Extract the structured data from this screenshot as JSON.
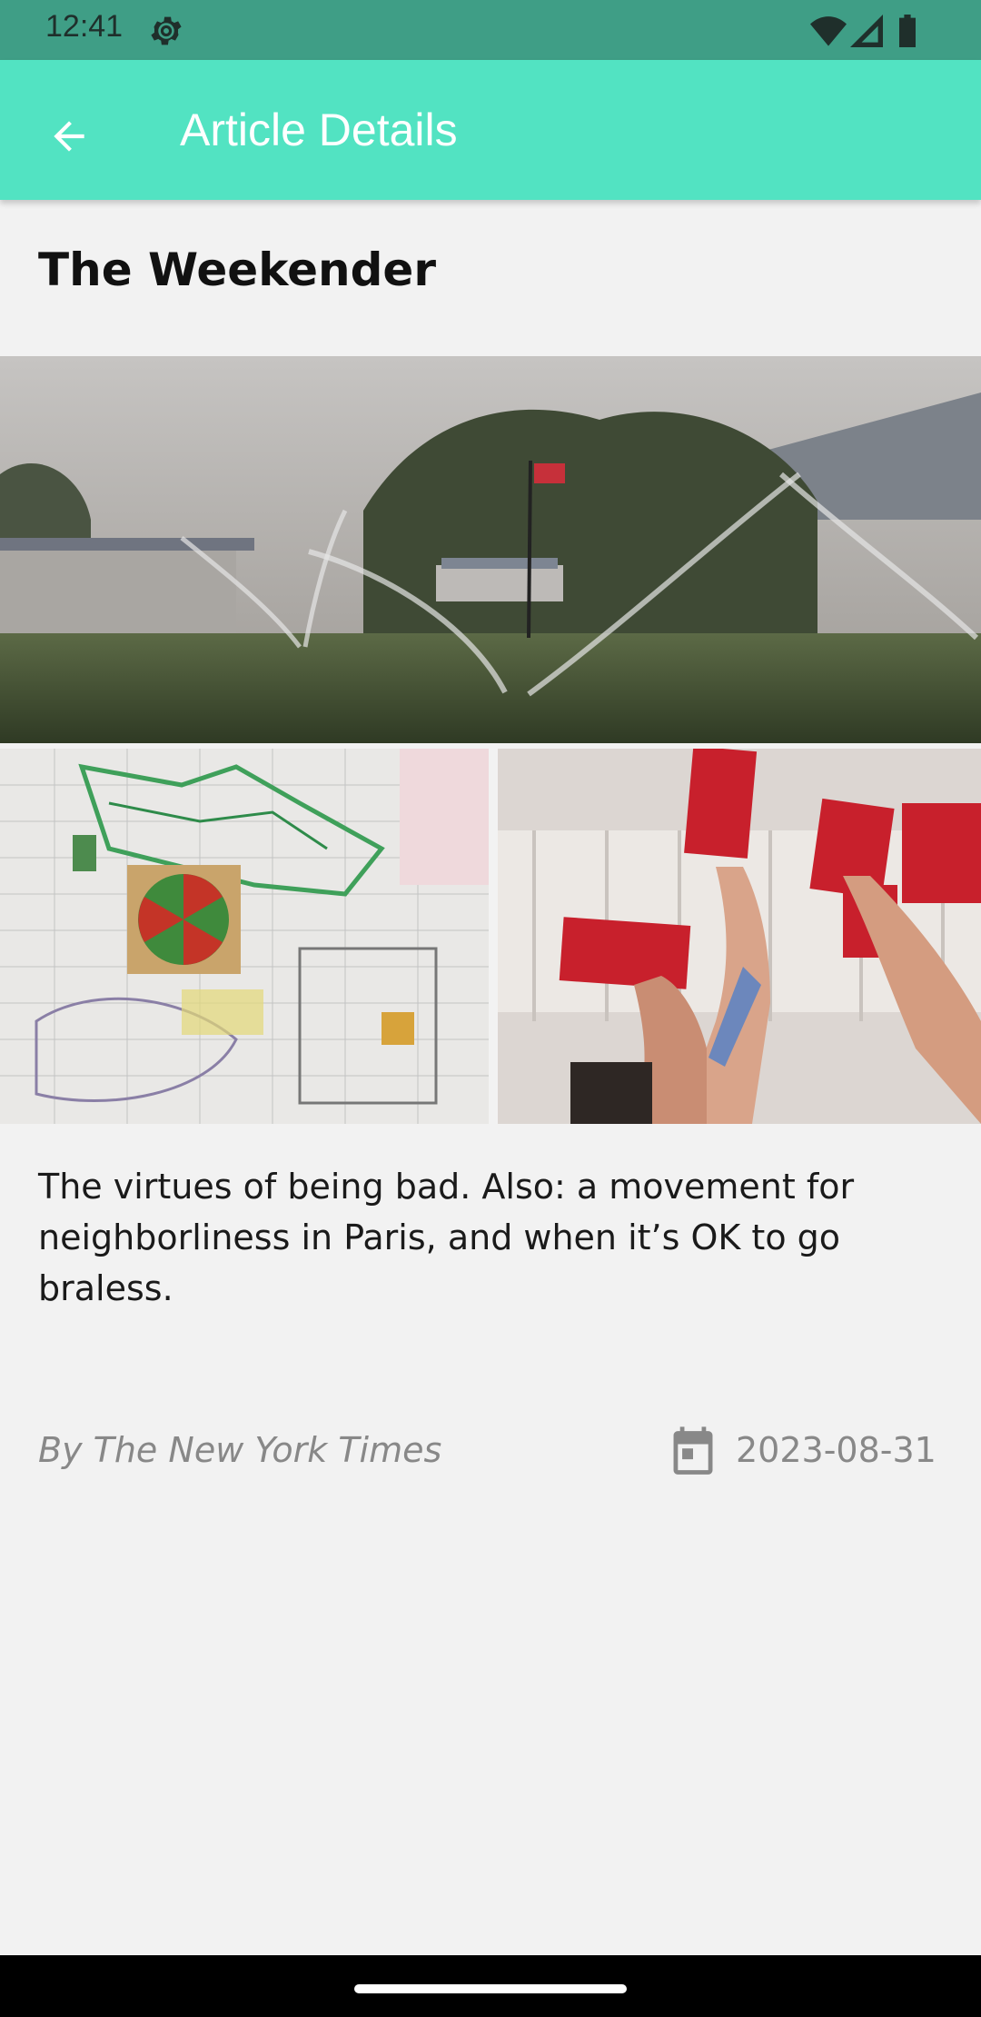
{
  "status_bar": {
    "time": "12:41",
    "icons": [
      "settings-gear-icon",
      "wifi-icon",
      "signal-icon",
      "battery-icon"
    ]
  },
  "app_bar": {
    "title": "Article Details",
    "back_icon": "arrow-back-icon",
    "background": "#52e3c2"
  },
  "article": {
    "title": "The Weekender",
    "summary": "The virtues of being bad. Also: a movement for neighborliness in Paris, and when it’s OK to go braless.",
    "byline": "By The New York Times",
    "date": "2023-08-31",
    "date_icon": "calendar-icon"
  },
  "colors": {
    "status_bar": "#3f9e86",
    "background": "#f2f2f2",
    "muted_text": "#888888"
  }
}
